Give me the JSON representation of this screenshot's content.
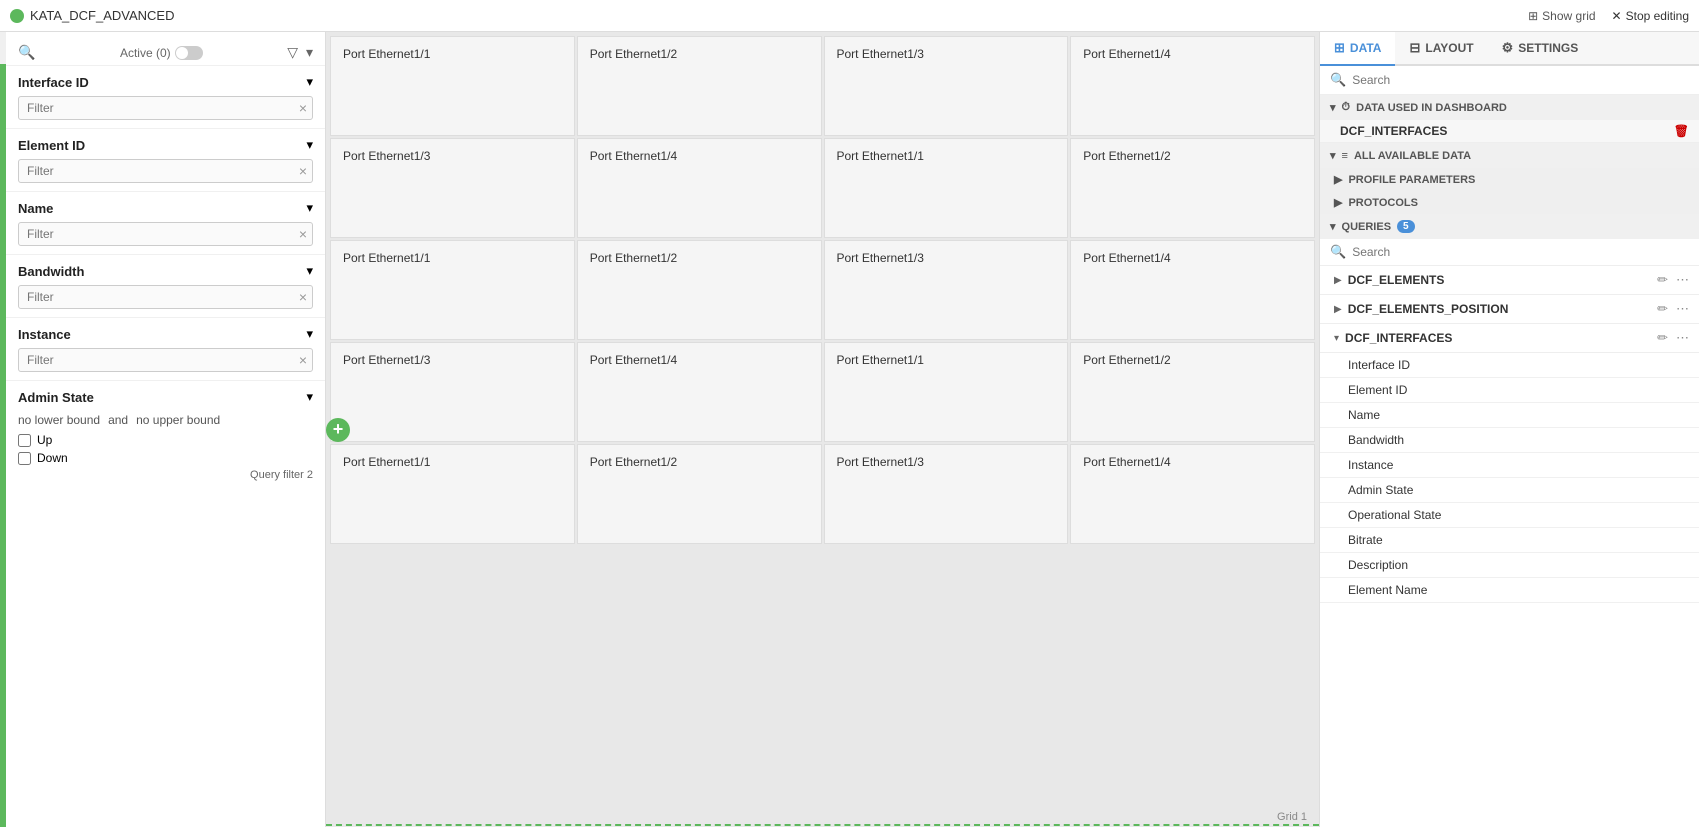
{
  "topbar": {
    "app_title": "KATA_DCF_ADVANCED",
    "show_grid_label": "Show grid",
    "stop_editing_label": "Stop editing"
  },
  "left_sidebar": {
    "active_label": "Active (0)",
    "filters": [
      {
        "id": "interface-id",
        "label": "Interface ID",
        "placeholder": "Filter"
      },
      {
        "id": "element-id",
        "label": "Element ID",
        "placeholder": "Filter"
      },
      {
        "id": "name",
        "label": "Name",
        "placeholder": "Filter"
      },
      {
        "id": "bandwidth",
        "label": "Bandwidth",
        "placeholder": "Filter"
      },
      {
        "id": "instance",
        "label": "Instance",
        "placeholder": "Filter"
      }
    ],
    "admin_state": {
      "label": "Admin State",
      "lower_bound": "no lower bound",
      "upper_bound": "no upper bound",
      "and_label": "and",
      "checkboxes": [
        {
          "label": "Up",
          "checked": false
        },
        {
          "label": "Down",
          "checked": false
        }
      ],
      "query_filter": "Query filter 2"
    }
  },
  "grid": {
    "cells": [
      [
        "Port Ethernet1/1",
        "Port Ethernet1/2",
        "Port Ethernet1/3",
        "Port Ethernet1/4"
      ],
      [
        "Port Ethernet1/3",
        "Port Ethernet1/4",
        "Port Ethernet1/1",
        "Port Ethernet1/2"
      ],
      [
        "Port Ethernet1/1",
        "Port Ethernet1/2",
        "Port Ethernet1/3",
        "Port Ethernet1/4"
      ],
      [
        "Port Ethernet1/3",
        "Port Ethernet1/4",
        "Port Ethernet1/1",
        "Port Ethernet1/2"
      ],
      [
        "Port Ethernet1/1",
        "Port Ethernet1/2",
        "Port Ethernet1/3",
        "Port Ethernet1/4"
      ]
    ],
    "footer_label": "Grid 1"
  },
  "right_sidebar": {
    "tabs": [
      {
        "id": "data",
        "label": "DATA",
        "icon": "table",
        "active": true
      },
      {
        "id": "layout",
        "label": "LAYOUT",
        "icon": "layout"
      },
      {
        "id": "settings",
        "label": "SETTINGS",
        "icon": "gear"
      }
    ],
    "search_placeholder": "Search",
    "data_used_header": "DATA USED IN DASHBOARD",
    "data_used_items": [
      {
        "id": "dcf-interfaces-used",
        "label": "DCF_INTERFACES"
      }
    ],
    "all_available_header": "ALL AVAILABLE DATA",
    "profile_parameters": "PROFILE PARAMETERS",
    "protocols": "PROTOCOLS",
    "queries_header": "QUERIES",
    "queries_count": "5",
    "queries_search_placeholder": "Search",
    "queries": [
      {
        "id": "dcf-elements",
        "label": "DCF_ELEMENTS",
        "expanded": false
      },
      {
        "id": "dcf-elements-position",
        "label": "DCF_ELEMENTS_POSITION",
        "expanded": false
      },
      {
        "id": "dcf-interfaces",
        "label": "DCF_INTERFACES",
        "expanded": true
      }
    ],
    "dcf_interfaces_fields": [
      "Interface ID",
      "Element ID",
      "Name",
      "Bandwidth",
      "Instance",
      "Admin State",
      "Operational State",
      "Bitrate",
      "Description",
      "Element Name"
    ]
  }
}
